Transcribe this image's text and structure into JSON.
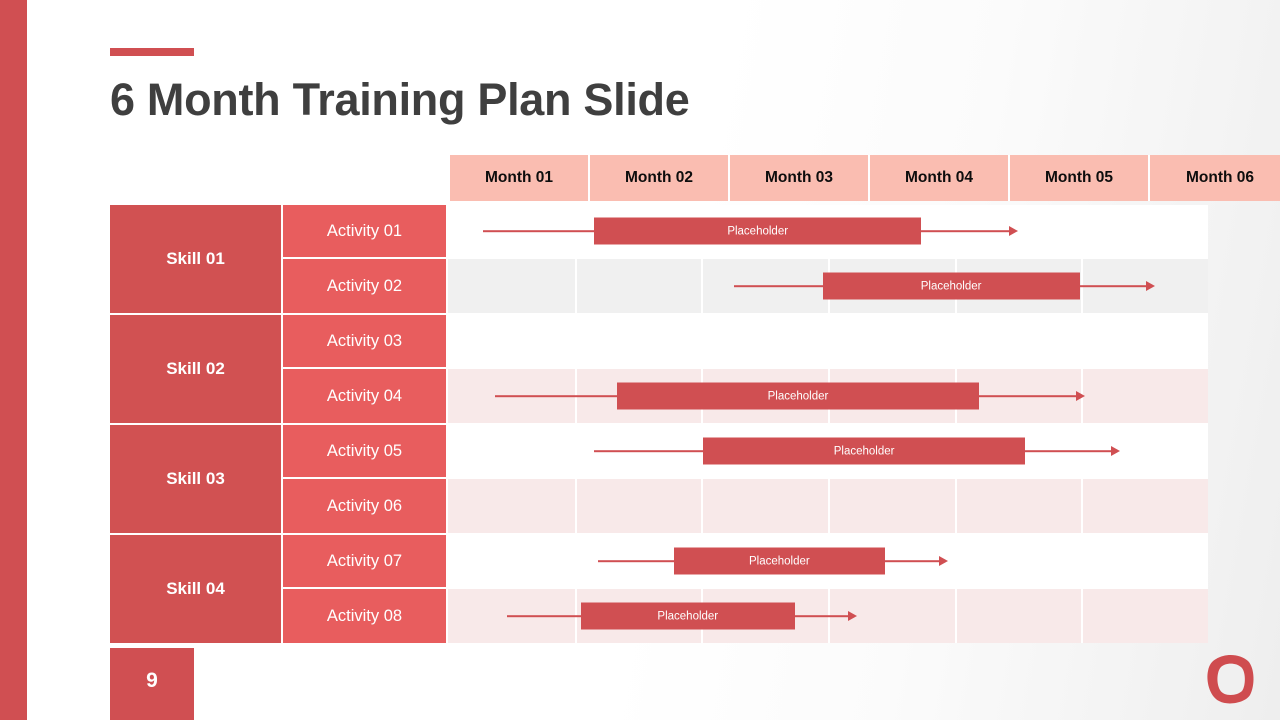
{
  "slide": {
    "title": "6 Month Training Plan Slide",
    "page_number": "9",
    "accent_color": "#d04f52",
    "title_color": "#3f3f3f",
    "month_header_color": "#fabdb1",
    "skill_cell_color": "#d15152",
    "activity_cell_color": "#e85d5e"
  },
  "timeline": {
    "months": [
      {
        "label": "Month 01"
      },
      {
        "label": "Month 02"
      },
      {
        "label": "Month 03"
      },
      {
        "label": "Month 04"
      },
      {
        "label": "Month 05"
      },
      {
        "label": "Month 06"
      }
    ]
  },
  "skills": [
    {
      "label": "Skill 01",
      "activities": [
        {
          "label": "Activity 01",
          "bar_label": "Placeholder",
          "shade": "white",
          "has_bar": true,
          "lead_start_pct": 4.6,
          "bar_start_pct": 19.2,
          "bar_end_pct": 62.3,
          "tail_end_pct": 75.0
        },
        {
          "label": "Activity 02",
          "bar_label": "Placeholder",
          "shade": "gray",
          "has_bar": true,
          "lead_start_pct": 37.6,
          "bar_start_pct": 49.3,
          "bar_end_pct": 83.1,
          "tail_end_pct": 93.0
        }
      ]
    },
    {
      "label": "Skill 02",
      "activities": [
        {
          "label": "Activity 03",
          "bar_label": "",
          "shade": "white",
          "has_bar": false,
          "lead_start_pct": 0,
          "bar_start_pct": 0,
          "bar_end_pct": 0,
          "tail_end_pct": 0
        },
        {
          "label": "Activity 04",
          "bar_label": "Placeholder",
          "shade": "pink",
          "has_bar": true,
          "lead_start_pct": 6.2,
          "bar_start_pct": 22.2,
          "bar_end_pct": 69.9,
          "tail_end_pct": 83.8
        }
      ]
    },
    {
      "label": "Skill 03",
      "activities": [
        {
          "label": "Activity 05",
          "bar_label": "Placeholder",
          "shade": "white",
          "has_bar": true,
          "lead_start_pct": 19.2,
          "bar_start_pct": 33.6,
          "bar_end_pct": 75.9,
          "tail_end_pct": 88.4
        },
        {
          "label": "Activity 06",
          "bar_label": "",
          "shade": "pink",
          "has_bar": false,
          "lead_start_pct": 0,
          "bar_start_pct": 0,
          "bar_end_pct": 0,
          "tail_end_pct": 0
        }
      ]
    },
    {
      "label": "Skill 04",
      "activities": [
        {
          "label": "Activity 07",
          "bar_label": "Placeholder",
          "shade": "white",
          "has_bar": true,
          "lead_start_pct": 19.8,
          "bar_start_pct": 29.7,
          "bar_end_pct": 57.5,
          "tail_end_pct": 65.8
        },
        {
          "label": "Activity 08",
          "bar_label": "Placeholder",
          "shade": "pink",
          "has_bar": true,
          "lead_start_pct": 7.8,
          "bar_start_pct": 17.5,
          "bar_end_pct": 45.6,
          "tail_end_pct": 53.8
        }
      ]
    }
  ]
}
